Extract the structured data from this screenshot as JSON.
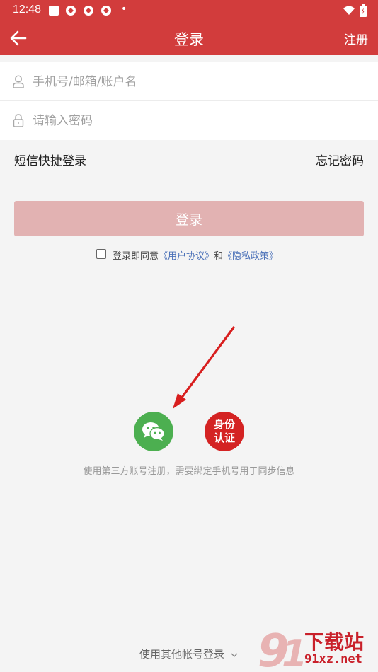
{
  "status_bar": {
    "time": "12:48",
    "dot": "•"
  },
  "app_bar": {
    "title": "登录",
    "register": "注册"
  },
  "form": {
    "account_placeholder": "手机号/邮箱/账户名",
    "password_placeholder": "请输入密码"
  },
  "links": {
    "sms_login": "短信快捷登录",
    "forgot_password": "忘记密码"
  },
  "login_button": "登录",
  "agreement": {
    "prefix": "登录即同意",
    "user_agreement": "《用户协议》",
    "and": "和",
    "privacy_policy": "《隐私政策》",
    "checked": false
  },
  "third_party": {
    "id_card_line1": "身份",
    "id_card_line2": "认证",
    "hint": "使用第三方账号注册，需要绑定手机号用于同步信息"
  },
  "other_login": "使用其他帐号登录",
  "watermark": {
    "brand": "下载站",
    "url": "91xz.net"
  },
  "colors": {
    "primary": "#d23c3c",
    "disabled_button": "#e2b2b2",
    "link": "#4a70b8",
    "wechat": "#4caf50",
    "id_card": "#d42323",
    "annotation_arrow": "#d81e1e"
  },
  "icons": [
    "back-arrow-icon",
    "user-icon",
    "lock-icon",
    "wechat-icon",
    "wifi-icon",
    "battery-icon",
    "chevron-down-icon",
    "annotation-arrow"
  ]
}
